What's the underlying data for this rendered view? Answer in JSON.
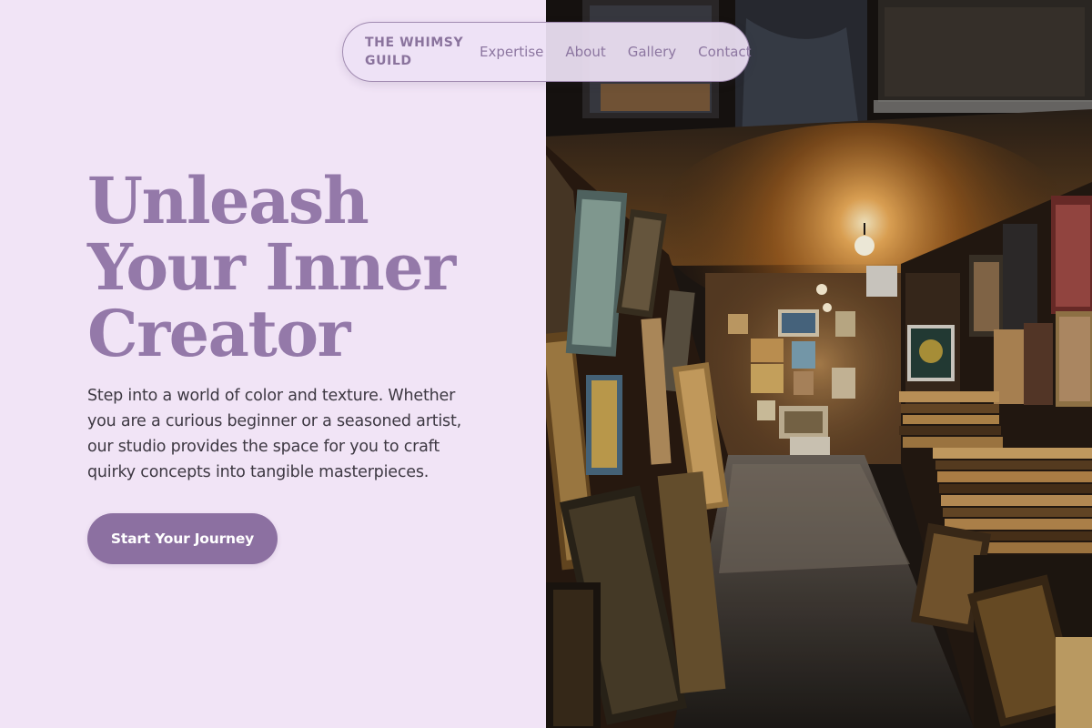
{
  "nav": {
    "brand_line1": "THE WHIMSY",
    "brand_line2": "GUILD",
    "links": [
      "Expertise",
      "About",
      "Gallery",
      "Contact"
    ]
  },
  "hero": {
    "headline": [
      "Unleash",
      "Your Inner",
      "Creator"
    ],
    "description": [
      "Step into a world of color and texture. Whether",
      "you are a curious beginner or a seasoned artist,",
      "our studio provides the space for you to craft",
      "quirky concepts into tangible masterpieces."
    ],
    "cta_label": "Start Your Journey"
  },
  "colors": {
    "background": "#f1e4f6",
    "accent": "#9479a9",
    "button": "#8c70a1",
    "body_text": "#3d3842"
  },
  "image": {
    "subject": "art-gallery-storage-room-photo"
  }
}
